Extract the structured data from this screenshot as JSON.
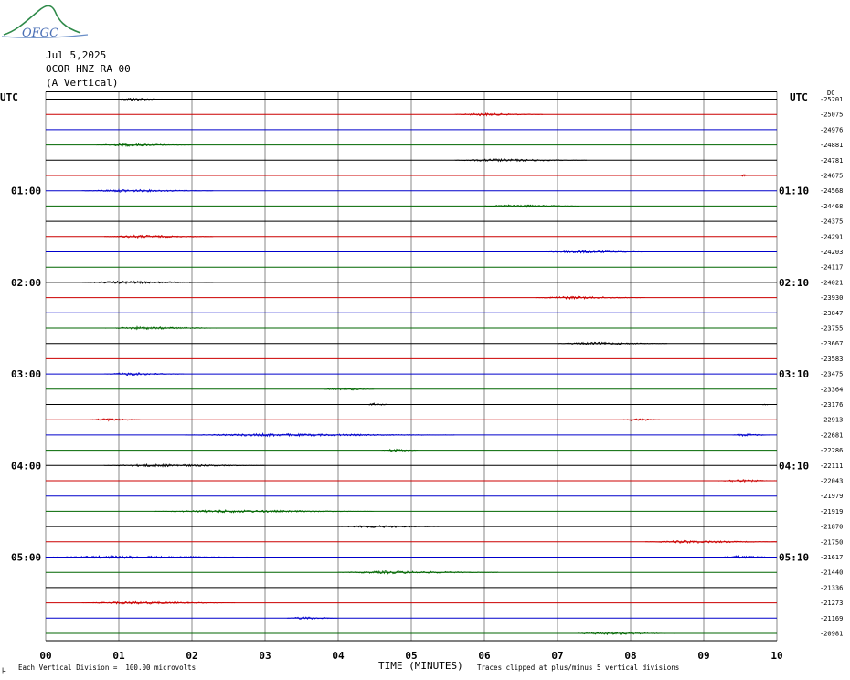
{
  "logo": {
    "text": "OFGC"
  },
  "header": {
    "date": "Jul 5,2025",
    "station": "OCOR HNZ RA 00",
    "component": "(A Vertical)"
  },
  "footer": {
    "scale_note": "Each Vertical Division =  100.00 microvolts",
    "x_title": "TIME (MINUTES)",
    "clip_note": "Traces clipped at plus/minus 5 vertical divisions",
    "corner_mark": "µ"
  },
  "chart_data": {
    "type": "line",
    "title": "",
    "xlabel": "TIME (MINUTES)",
    "xlim": [
      0,
      10
    ],
    "x_ticks": [
      "00",
      "01",
      "02",
      "03",
      "04",
      "05",
      "06",
      "07",
      "08",
      "09",
      "10"
    ],
    "left_axis_label": "UTC",
    "right_axis_label": "UTC",
    "dc_label": "DC",
    "left_time_labels": [
      {
        "trace": 6,
        "label": "01:00"
      },
      {
        "trace": 12,
        "label": "02:00"
      },
      {
        "trace": 18,
        "label": "03:00"
      },
      {
        "trace": 24,
        "label": "04:00"
      },
      {
        "trace": 30,
        "label": "05:00"
      }
    ],
    "right_time_labels": [
      {
        "trace": 6,
        "label": "01:10"
      },
      {
        "trace": 12,
        "label": "02:10"
      },
      {
        "trace": 18,
        "label": "03:10"
      },
      {
        "trace": 24,
        "label": "04:10"
      },
      {
        "trace": 30,
        "label": "05:10"
      }
    ],
    "series_colors": [
      "#000000",
      "#cc0000",
      "#0000cc",
      "#006600"
    ],
    "grid": true,
    "traces": [
      {
        "dc": "-25201",
        "events": [
          [
            1.0,
            1.6
          ]
        ]
      },
      {
        "dc": "-25075",
        "events": [
          [
            5.6,
            6.8
          ]
        ]
      },
      {
        "dc": "-24976",
        "events": []
      },
      {
        "dc": "-24881",
        "events": [
          [
            0.7,
            2.0
          ]
        ]
      },
      {
        "dc": "-24781",
        "events": [
          [
            5.6,
            7.4
          ]
        ]
      },
      {
        "dc": "-24675",
        "events": [
          [
            9.5,
            9.6
          ]
        ]
      },
      {
        "dc": "-24568",
        "events": [
          [
            0.5,
            2.3
          ]
        ]
      },
      {
        "dc": "-24468",
        "events": [
          [
            6.0,
            7.3
          ]
        ]
      },
      {
        "dc": "-24375",
        "events": []
      },
      {
        "dc": "-24291",
        "events": [
          [
            0.8,
            2.3
          ]
        ]
      },
      {
        "dc": "-24203",
        "events": [
          [
            6.8,
            8.3
          ]
        ]
      },
      {
        "dc": "-24117",
        "events": []
      },
      {
        "dc": "-24021",
        "events": [
          [
            0.5,
            2.3
          ]
        ]
      },
      {
        "dc": "-23930",
        "events": [
          [
            6.7,
            8.2
          ]
        ]
      },
      {
        "dc": "-23847",
        "events": []
      },
      {
        "dc": "-23755",
        "events": [
          [
            0.8,
            2.4
          ]
        ]
      },
      {
        "dc": "-23667",
        "events": [
          [
            7.0,
            8.5
          ]
        ]
      },
      {
        "dc": "-23583",
        "events": []
      },
      {
        "dc": "-23475",
        "events": [
          [
            0.8,
            1.9
          ]
        ]
      },
      {
        "dc": "-23364",
        "events": [
          [
            3.8,
            4.5
          ]
        ]
      },
      {
        "dc": "-23176",
        "events": [
          [
            4.4,
            4.7
          ],
          [
            9.8,
            9.9
          ]
        ]
      },
      {
        "dc": "-22913",
        "events": [
          [
            0.6,
            1.3
          ],
          [
            7.9,
            8.4
          ]
        ]
      },
      {
        "dc": "-22681",
        "events": [
          [
            1.9,
            5.6
          ],
          [
            9.4,
            9.9
          ]
        ]
      },
      {
        "dc": "-22286",
        "events": [
          [
            4.6,
            5.1
          ]
        ]
      },
      {
        "dc": "-22111",
        "events": [
          [
            0.8,
            3.0
          ]
        ]
      },
      {
        "dc": "-22043",
        "events": [
          [
            9.2,
            10.0
          ]
        ]
      },
      {
        "dc": "-21979",
        "events": []
      },
      {
        "dc": "-21919",
        "events": [
          [
            1.5,
            4.5
          ]
        ]
      },
      {
        "dc": "-21870",
        "events": [
          [
            4.0,
            5.4
          ]
        ]
      },
      {
        "dc": "-21750",
        "events": [
          [
            8.2,
            10.0
          ]
        ]
      },
      {
        "dc": "-21617",
        "events": [
          [
            0.0,
            2.9
          ],
          [
            9.2,
            10.0
          ]
        ]
      },
      {
        "dc": "-21440",
        "events": [
          [
            4.0,
            6.2
          ]
        ]
      },
      {
        "dc": "-21336",
        "events": []
      },
      {
        "dc": "-21273",
        "events": [
          [
            0.5,
            2.6
          ]
        ]
      },
      {
        "dc": "-21169",
        "events": [
          [
            3.3,
            4.0
          ]
        ]
      },
      {
        "dc": "-20981",
        "events": [
          [
            7.2,
            8.6
          ]
        ]
      }
    ]
  }
}
